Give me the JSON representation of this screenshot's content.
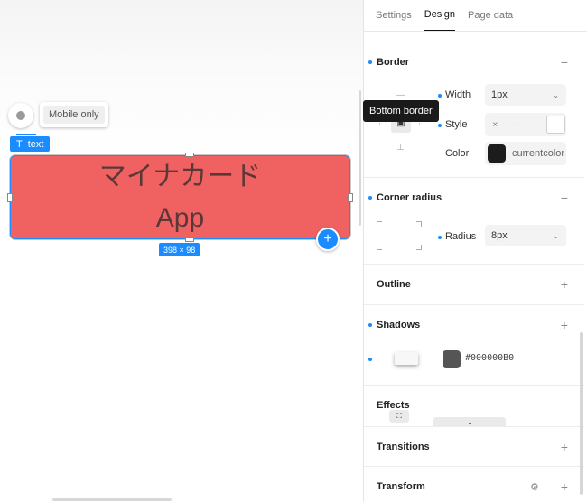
{
  "canvas": {
    "view_chip": "Mobile only",
    "element_label": "text",
    "element_text_line1": "マイナカード",
    "element_text_line2": "App",
    "element_color": "#F06262",
    "size_badge": "398 × 98",
    "add_icon": "plus-icon"
  },
  "panel": {
    "tabs": [
      "Settings",
      "Design",
      "Page data"
    ],
    "active_tab": "Design",
    "border": {
      "title": "Border",
      "action": "−",
      "width_label": "Width",
      "width_value": "1px",
      "style_label": "Style",
      "style_options": [
        "×",
        "–",
        "···",
        "—"
      ],
      "style_selected": "—",
      "color_label": "Color",
      "color_value": "currentcolor",
      "tooltip": "Bottom border"
    },
    "corner_radius": {
      "title": "Corner radius",
      "action": "−",
      "radius_label": "Radius",
      "radius_value": "8px"
    },
    "outline": {
      "title": "Outline",
      "action": "+"
    },
    "shadows": {
      "title": "Shadows",
      "action": "+",
      "color": "#000000B0"
    },
    "effects": {
      "title": "Effects"
    },
    "transitions": {
      "title": "Transitions",
      "action": "+"
    },
    "transform": {
      "title": "Transform",
      "action": "+"
    }
  },
  "colors": {
    "accent": "#1A8CFF",
    "tooltip_bg": "#1A1A1A"
  }
}
